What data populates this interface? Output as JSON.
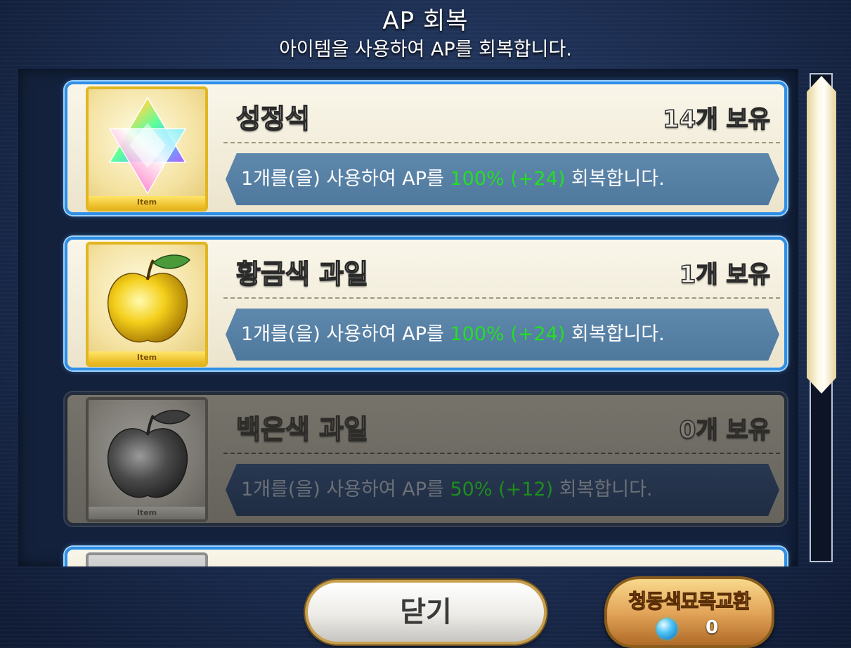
{
  "header": {
    "title": "AP 회복",
    "subtitle": "아이템을 사용하여 AP를 회복합니다."
  },
  "items": [
    {
      "name": "성정석",
      "count": "14개 보유",
      "tag": "Item",
      "icon": "saint-quartz-icon",
      "desc_prefix": "1개를(을) 사용하여 AP를 ",
      "desc_value": "100% (+24)",
      "desc_suffix": " 회복합니다.",
      "enabled": true
    },
    {
      "name": "황금색 과일",
      "count": "1개 보유",
      "tag": "Item",
      "icon": "golden-apple-icon",
      "desc_prefix": "1개를(을) 사용하여 AP를 ",
      "desc_value": "100% (+24)",
      "desc_suffix": " 회복합니다.",
      "enabled": true
    },
    {
      "name": "백은색 과일",
      "count": "0개 보유",
      "tag": "Item",
      "icon": "silver-apple-icon",
      "desc_prefix": "1개를(을) 사용하여 AP를 ",
      "desc_value": "50% (+12)",
      "desc_suffix": " 회복합니다.",
      "enabled": false
    }
  ],
  "buttons": {
    "close_label": "닫기",
    "exchange_label": "청동색묘목교환",
    "exchange_count": "0",
    "exchange_icon": "blue-gem-icon"
  },
  "colors": {
    "card_border": "#2f8fe6",
    "value_green": "#23e020",
    "desc_bar": "#5f88ad"
  }
}
